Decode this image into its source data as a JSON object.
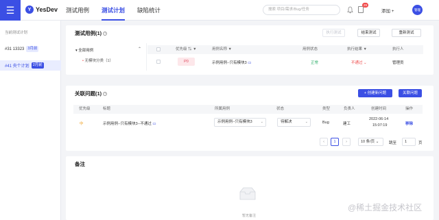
{
  "header": {
    "logo_text": "YesDev",
    "nav": [
      "测试用例",
      "测试计划",
      "缺陷统计"
    ],
    "active_nav": "测试计划",
    "search_placeholder": "搜索 项目/需求/Bug/任务",
    "notification_count": "29",
    "add_label": "添加 +",
    "avatar_text": "管理"
  },
  "sidebar": {
    "heading": "当前测试计划",
    "plans": [
      {
        "label": "#31 13323",
        "tag": "3月前"
      },
      {
        "label": "#41 央个计划",
        "tag": "2月前"
      }
    ]
  },
  "cases_card": {
    "title": "测试用例(1)",
    "buttons": {
      "disabled_action": "执行测试",
      "finish": "结束测试",
      "retest": "重新测试"
    },
    "tree": {
      "root": "全部用例",
      "child": "无模块分类（1）"
    },
    "columns": [
      "优先级",
      "用例名称",
      "用例状态",
      "执行结果",
      "执行人"
    ],
    "rows": [
      {
        "priority": "P0",
        "name": "示例用例--只有模块3",
        "status": "正常",
        "result": "不通过",
        "executor": "管理员"
      }
    ]
  },
  "issues_card": {
    "title": "关联问题(1)",
    "buttons": {
      "create": "+ 创建新问题",
      "link": "关联问题"
    },
    "columns": [
      "优先级",
      "标题",
      "所属用例",
      "状态",
      "类型",
      "负责人",
      "创建时间",
      "操作"
    ],
    "rows": [
      {
        "priority": "中",
        "title": "示例用例--只有模块3--不通过",
        "case": "示例用例--只有模块3",
        "status": "待解决",
        "type": "Bug",
        "owner": "建工",
        "created_date": "2022-06-14",
        "created_time": "15:07:19",
        "action": "移除"
      }
    ],
    "pagination": {
      "current_page": "1",
      "page_size": "10 条/页",
      "goto_label": "跳至",
      "goto_value": "1",
      "goto_suffix": "页"
    }
  },
  "notes_card": {
    "title": "备注",
    "empty_text": "暂无备注"
  },
  "watermark": "@稀土掘金技术社区",
  "colors": {
    "accent": "#3b4fe4",
    "danger": "#ef4c4c",
    "success": "#2eae6a",
    "warning": "#f0a020"
  }
}
